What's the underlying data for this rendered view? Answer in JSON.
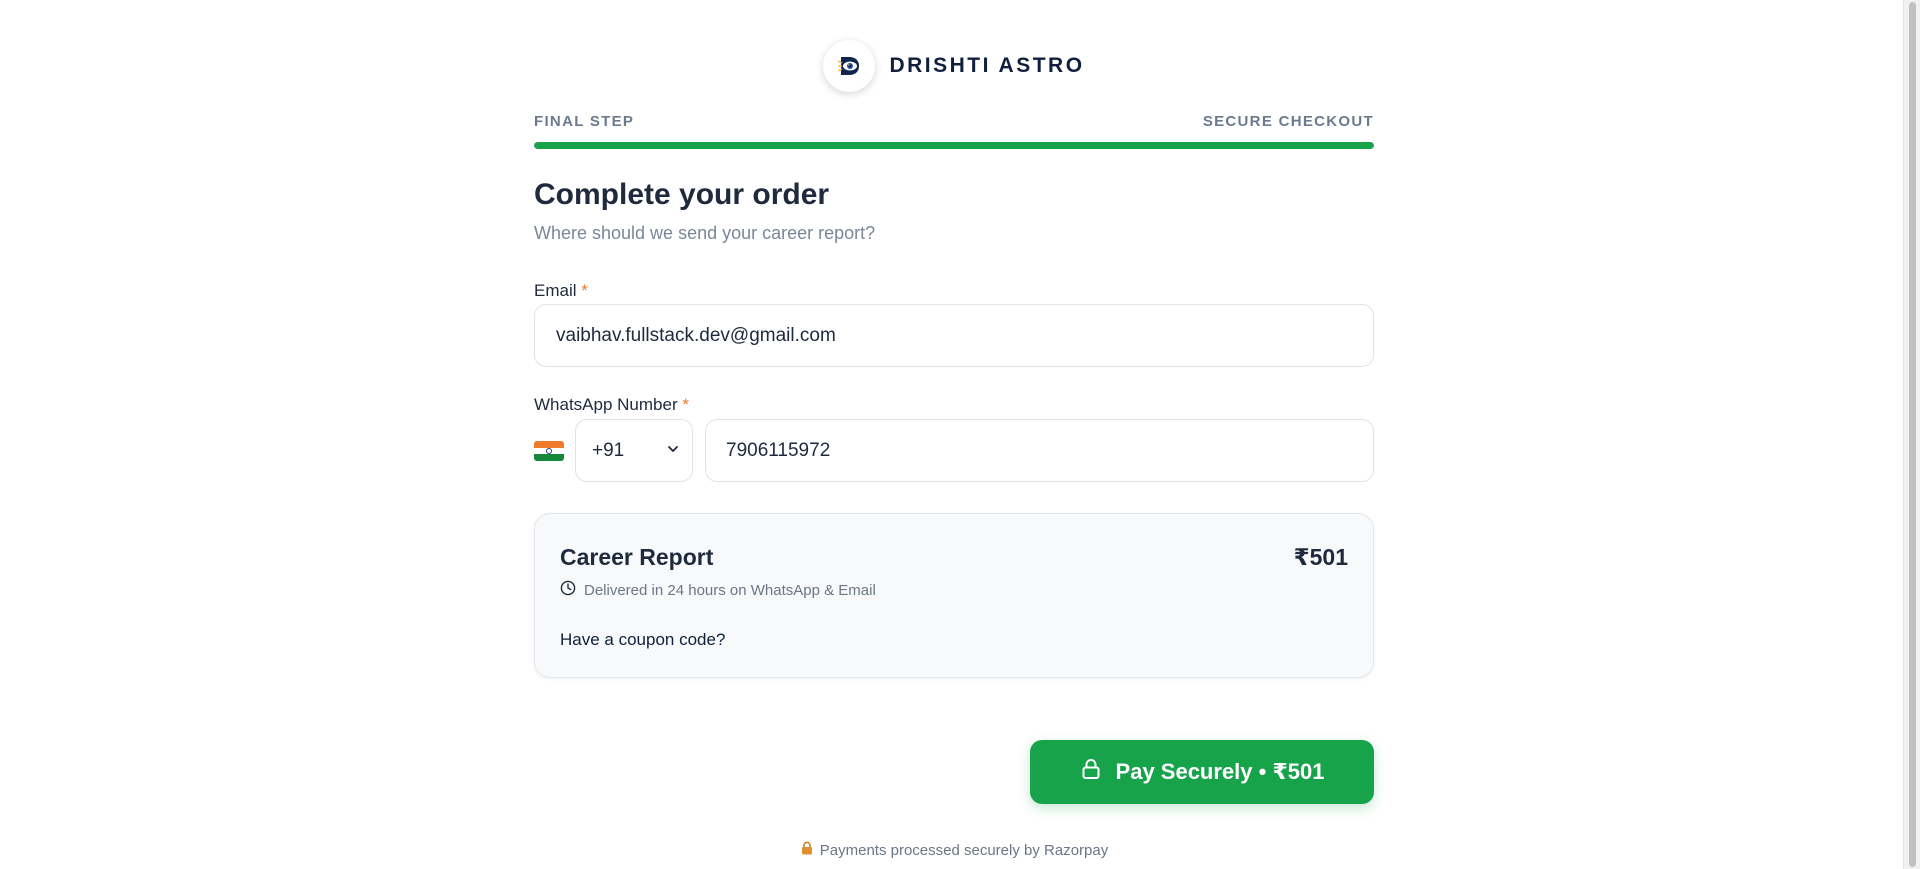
{
  "brand": {
    "name": "DRISHTI ASTRO",
    "logo_icon": "astro-eye-logo"
  },
  "progress": {
    "left_label": "FINAL STEP",
    "right_label": "SECURE CHECKOUT",
    "percent": 100,
    "color": "#16a34a"
  },
  "header": {
    "title": "Complete your order",
    "subtitle": "Where should we send your career report?"
  },
  "form": {
    "email": {
      "label": "Email",
      "required_mark": "*",
      "value": "vaibhav.fullstack.dev@gmail.com"
    },
    "whatsapp": {
      "label": "WhatsApp Number",
      "required_mark": "*",
      "country_code": "+91",
      "flag": "india-flag",
      "value": "7906115972"
    }
  },
  "order": {
    "product": "Career Report",
    "price": "₹501",
    "delivery_text": "Delivered in 24 hours on WhatsApp & Email",
    "coupon_link": "Have a coupon code?"
  },
  "pay_button": {
    "label": "Pay Securely • ₹501",
    "color": "#16a34a"
  },
  "footer": {
    "note": "Payments processed securely by Razorpay",
    "icon": "lock-icon"
  }
}
